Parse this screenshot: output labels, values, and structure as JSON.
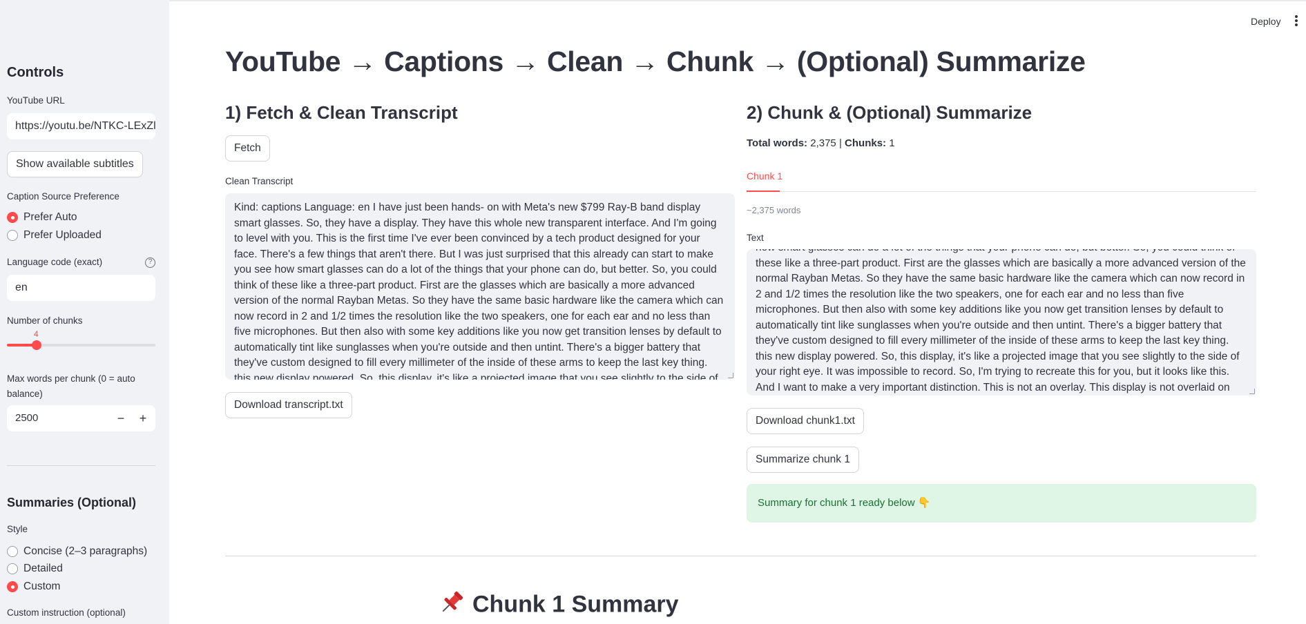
{
  "header": {
    "deploy_label": "Deploy"
  },
  "sidebar": {
    "title": "Controls",
    "youtube_url_label": "YouTube URL",
    "youtube_url_value": "https://youtu.be/NTKC-LExZl",
    "show_subs_label": "Show available subtitles",
    "caption_pref_label": "Caption Source Preference",
    "caption_options": [
      "Prefer Auto",
      "Prefer Uploaded"
    ],
    "caption_selected": "Prefer Auto",
    "lang_label": "Language code (exact)",
    "lang_value": "en",
    "help_glyph": "?",
    "chunks_label": "Number of chunks",
    "chunks_value": "4",
    "chunks_slider_fraction": 0.2,
    "maxwords_label": "Max words per chunk (0 = auto balance)",
    "maxwords_value": "2500",
    "minus_glyph": "−",
    "plus_glyph": "+",
    "summaries_title": "Summaries (Optional)",
    "style_label": "Style",
    "style_options": [
      "Concise (2–3 paragraphs)",
      "Detailed",
      "Custom"
    ],
    "style_selected": "Custom",
    "custom_instruction_label": "Custom instruction (optional)"
  },
  "main": {
    "title": "YouTube → Captions → Clean → Chunk → (Optional) Summarize",
    "left": {
      "heading": "1) Fetch & Clean Transcript",
      "fetch_label": "Fetch",
      "transcript_label": "Clean Transcript",
      "transcript_text": "Kind: captions Language: en I have just been hands- on with Meta's new $799 Ray-B band display smart glasses. So, they have a display. They have this whole new transparent interface. And I'm going to level with you. This is the first time I've ever been convinced by a tech product designed for your face. There's a few things that aren't there. But I was just surprised that this already can start to make you see how smart glasses can do a lot of the things that your phone can do, but better. So, you could think of these like a three-part product. First are the glasses which are basically a more advanced version of the normal Rayban Metas. So they have the same basic hardware like the camera which can now record in 2 and 1/2 times the resolution like the two speakers, one for each ear and no less than five microphones. But then also with some key additions like you now get transition lenses by default to automatically tint like sunglasses when you're outside and then untint. There's a bigger battery that they've custom designed to fill every millimeter of the inside of these arms to keep the last key thing. this new display powered. So, this display, it's like a projected image that you see slightly to the side of your right eye. It was impossible",
      "download_label": "Download transcript.txt"
    },
    "right": {
      "heading": "2) Chunk & (Optional) Summarize",
      "total_words_label": "Total words:",
      "total_words_value": "2,375",
      "separator": "|",
      "chunks_label": "Chunks:",
      "chunks_value": "1",
      "tab_label": "Chunk 1",
      "words_estimate": "~2,375 words",
      "text_label": "Text",
      "chunk_text": "how smart glasses can do a lot of the things that your phone can do, but better. So, you could think of these like a three-part product. First are the glasses which are basically a more advanced version of the normal Rayban Metas. So they have the same basic hardware like the camera which can now record in 2 and 1/2 times the resolution like the two speakers, one for each ear and no less than five microphones. But then also with some key additions like you now get transition lenses by default to automatically tint like sunglasses when you're outside and then untint. There's a bigger battery that they've custom designed to fill every millimeter of the inside of these arms to keep the last key thing. this new display powered. So, this display, it's like a projected image that you see slightly to the side of your right eye. It was impossible to record. So, I'm trying to recreate this for you, but it looks like this. And I want to make a very important distinction. This is not an overlay. This display is not overlaid on your surroundings. It's just",
      "download_label": "Download chunk1.txt",
      "summarize_label": "Summarize chunk 1",
      "success_text": "Summary for chunk 1 ready below 👇"
    },
    "summary_heading": "Chunk 1 Summary"
  }
}
